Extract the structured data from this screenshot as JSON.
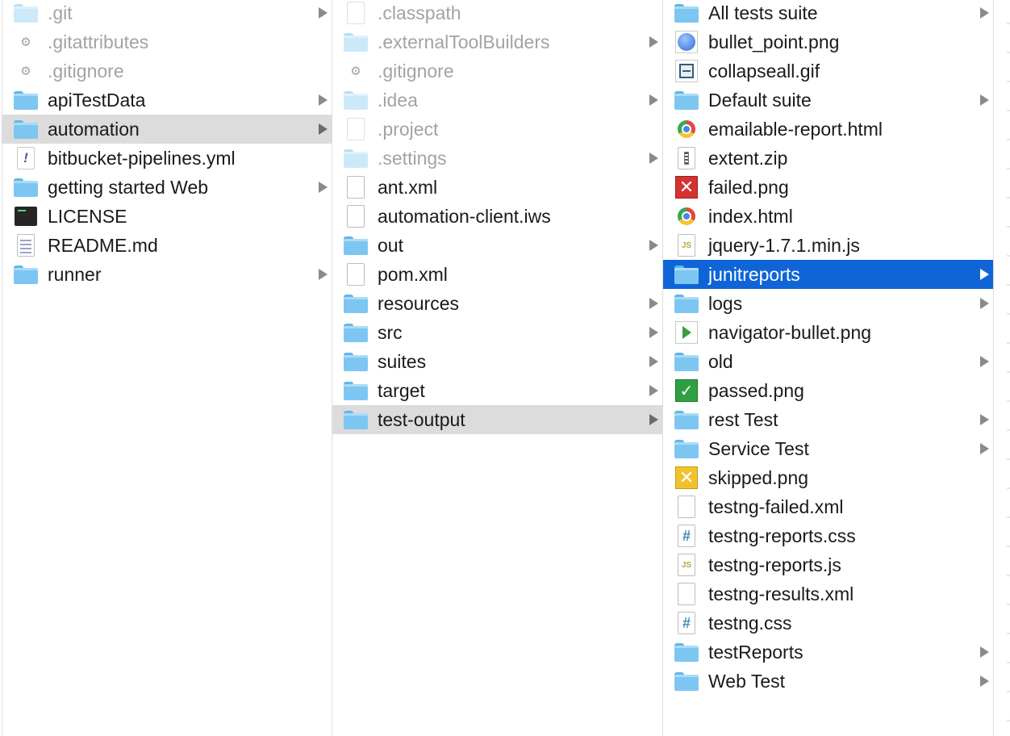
{
  "columns": [
    {
      "id": "col1",
      "items": [
        {
          "label": ".git",
          "type": "folder",
          "icon": "folder-icon",
          "dim": true,
          "hasChildren": true
        },
        {
          "label": ".gitattributes",
          "type": "file",
          "icon": "gear-icon",
          "dim": true
        },
        {
          "label": ".gitignore",
          "type": "file",
          "icon": "gear-icon",
          "dim": true
        },
        {
          "label": "apiTestData",
          "type": "folder",
          "icon": "folder-icon",
          "hasChildren": true
        },
        {
          "label": "automation",
          "type": "folder",
          "icon": "folder-icon",
          "hasChildren": true,
          "selected": "gray"
        },
        {
          "label": "bitbucket-pipelines.yml",
          "type": "file",
          "icon": "yaml-file-icon"
        },
        {
          "label": "getting started Web",
          "type": "folder",
          "icon": "folder-icon",
          "hasChildren": true
        },
        {
          "label": "LICENSE",
          "type": "file",
          "icon": "terminal-file-icon"
        },
        {
          "label": "README.md",
          "type": "file",
          "icon": "text-document-icon"
        },
        {
          "label": "runner",
          "type": "folder",
          "icon": "folder-icon",
          "hasChildren": true
        }
      ]
    },
    {
      "id": "col2",
      "items": [
        {
          "label": ".classpath",
          "type": "file",
          "icon": "document-icon",
          "dim": true
        },
        {
          "label": ".externalToolBuilders",
          "type": "folder",
          "icon": "folder-icon",
          "dim": true,
          "hasChildren": true
        },
        {
          "label": ".gitignore",
          "type": "file",
          "icon": "gear-icon",
          "dim": true
        },
        {
          "label": ".idea",
          "type": "folder",
          "icon": "folder-icon",
          "dim": true,
          "hasChildren": true
        },
        {
          "label": ".project",
          "type": "file",
          "icon": "document-icon",
          "dim": true
        },
        {
          "label": ".settings",
          "type": "folder",
          "icon": "folder-icon",
          "dim": true,
          "hasChildren": true
        },
        {
          "label": "ant.xml",
          "type": "file",
          "icon": "document-icon"
        },
        {
          "label": "automation-client.iws",
          "type": "file",
          "icon": "document-icon"
        },
        {
          "label": "out",
          "type": "folder",
          "icon": "folder-icon",
          "hasChildren": true
        },
        {
          "label": "pom.xml",
          "type": "file",
          "icon": "document-icon"
        },
        {
          "label": "resources",
          "type": "folder",
          "icon": "folder-icon",
          "hasChildren": true
        },
        {
          "label": "src",
          "type": "folder",
          "icon": "folder-icon",
          "hasChildren": true
        },
        {
          "label": "suites",
          "type": "folder",
          "icon": "folder-icon",
          "hasChildren": true
        },
        {
          "label": "target",
          "type": "folder",
          "icon": "folder-icon",
          "hasChildren": true
        },
        {
          "label": "test-output",
          "type": "folder",
          "icon": "folder-icon",
          "hasChildren": true,
          "selected": "gray"
        }
      ]
    },
    {
      "id": "col3",
      "items": [
        {
          "label": "All tests suite",
          "type": "folder",
          "icon": "folder-icon",
          "hasChildren": true
        },
        {
          "label": "bullet_point.png",
          "type": "file",
          "icon": "bullet-image-icon"
        },
        {
          "label": "collapseall.gif",
          "type": "file",
          "icon": "collapse-image-icon"
        },
        {
          "label": "Default suite",
          "type": "folder",
          "icon": "folder-icon",
          "hasChildren": true
        },
        {
          "label": "emailable-report.html",
          "type": "file",
          "icon": "chrome-html-icon"
        },
        {
          "label": "extent.zip",
          "type": "file",
          "icon": "zip-file-icon"
        },
        {
          "label": "failed.png",
          "type": "file",
          "icon": "failed-image-icon"
        },
        {
          "label": "index.html",
          "type": "file",
          "icon": "chrome-html-icon"
        },
        {
          "label": "jquery-1.7.1.min.js",
          "type": "file",
          "icon": "js-file-icon"
        },
        {
          "label": "junitreports",
          "type": "folder",
          "icon": "folder-icon",
          "hasChildren": true,
          "selected": "blue"
        },
        {
          "label": "logs",
          "type": "folder",
          "icon": "folder-icon",
          "hasChildren": true
        },
        {
          "label": "navigator-bullet.png",
          "type": "file",
          "icon": "navigator-image-icon"
        },
        {
          "label": "old",
          "type": "folder",
          "icon": "folder-icon",
          "hasChildren": true
        },
        {
          "label": "passed.png",
          "type": "file",
          "icon": "passed-image-icon"
        },
        {
          "label": "rest Test",
          "type": "folder",
          "icon": "folder-icon",
          "hasChildren": true
        },
        {
          "label": "Service Test",
          "type": "folder",
          "icon": "folder-icon",
          "hasChildren": true
        },
        {
          "label": "skipped.png",
          "type": "file",
          "icon": "skipped-image-icon"
        },
        {
          "label": "testng-failed.xml",
          "type": "file",
          "icon": "document-icon"
        },
        {
          "label": "testng-reports.css",
          "type": "file",
          "icon": "css-file-icon"
        },
        {
          "label": "testng-reports.js",
          "type": "file",
          "icon": "js-file-icon"
        },
        {
          "label": "testng-results.xml",
          "type": "file",
          "icon": "document-icon"
        },
        {
          "label": "testng.css",
          "type": "file",
          "icon": "css-file-icon"
        },
        {
          "label": "testReports",
          "type": "folder",
          "icon": "folder-icon",
          "hasChildren": true
        },
        {
          "label": "Web Test",
          "type": "folder",
          "icon": "folder-icon",
          "hasChildren": true
        }
      ]
    }
  ],
  "colors": {
    "selectionBlue": "#0f65d8",
    "selectionGray": "#dcdcdc",
    "folderBlue": "#7dc6f2",
    "dimText": "#a3a3a3"
  }
}
